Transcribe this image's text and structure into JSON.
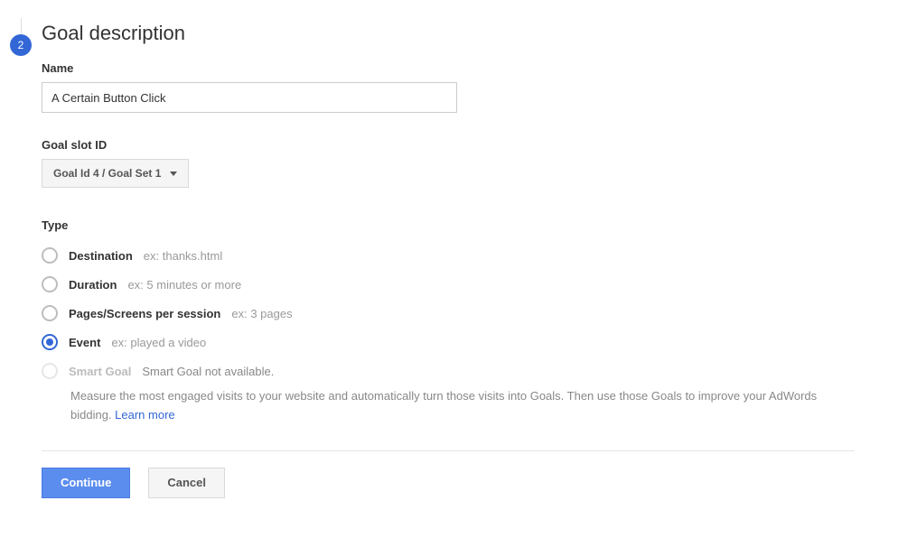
{
  "step": {
    "number": "2",
    "title": "Goal description"
  },
  "fields": {
    "name_label": "Name",
    "name_value": "A Certain Button Click",
    "slot_label": "Goal slot ID",
    "slot_value": "Goal Id 4 / Goal Set 1",
    "type_label": "Type"
  },
  "types": {
    "destination": {
      "label": "Destination",
      "hint": "ex: thanks.html",
      "selected": false,
      "disabled": false
    },
    "duration": {
      "label": "Duration",
      "hint": "ex: 5 minutes or more",
      "selected": false,
      "disabled": false
    },
    "pages": {
      "label": "Pages/Screens per session",
      "hint": "ex: 3 pages",
      "selected": false,
      "disabled": false
    },
    "event": {
      "label": "Event",
      "hint": "ex: played a video",
      "selected": true,
      "disabled": false
    },
    "smart": {
      "label": "Smart Goal",
      "hint": "Smart Goal not available.",
      "selected": false,
      "disabled": true
    }
  },
  "smart_desc": {
    "text": "Measure the most engaged visits to your website and automatically turn those visits into Goals. Then use those Goals to improve your AdWords bidding. ",
    "link": "Learn more"
  },
  "buttons": {
    "continue": "Continue",
    "cancel": "Cancel"
  }
}
